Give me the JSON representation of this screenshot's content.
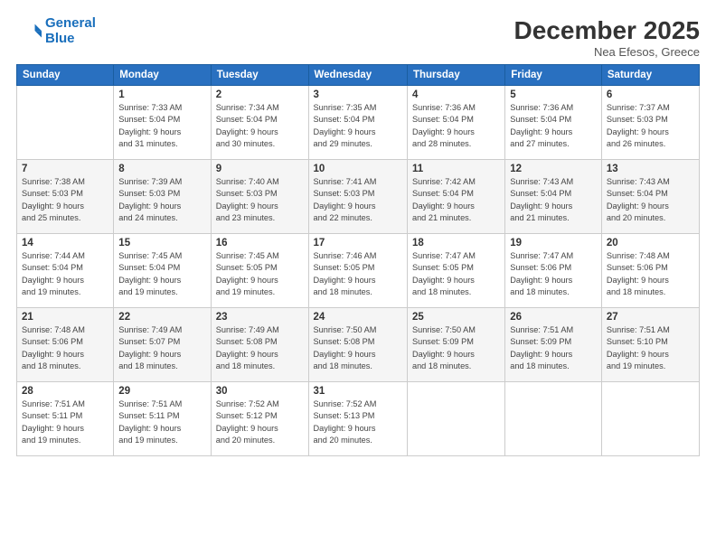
{
  "logo": {
    "line1": "General",
    "line2": "Blue"
  },
  "title": "December 2025",
  "location": "Nea Efesos, Greece",
  "header_days": [
    "Sunday",
    "Monday",
    "Tuesday",
    "Wednesday",
    "Thursday",
    "Friday",
    "Saturday"
  ],
  "weeks": [
    [
      {
        "day": "",
        "info": ""
      },
      {
        "day": "1",
        "info": "Sunrise: 7:33 AM\nSunset: 5:04 PM\nDaylight: 9 hours\nand 31 minutes."
      },
      {
        "day": "2",
        "info": "Sunrise: 7:34 AM\nSunset: 5:04 PM\nDaylight: 9 hours\nand 30 minutes."
      },
      {
        "day": "3",
        "info": "Sunrise: 7:35 AM\nSunset: 5:04 PM\nDaylight: 9 hours\nand 29 minutes."
      },
      {
        "day": "4",
        "info": "Sunrise: 7:36 AM\nSunset: 5:04 PM\nDaylight: 9 hours\nand 28 minutes."
      },
      {
        "day": "5",
        "info": "Sunrise: 7:36 AM\nSunset: 5:04 PM\nDaylight: 9 hours\nand 27 minutes."
      },
      {
        "day": "6",
        "info": "Sunrise: 7:37 AM\nSunset: 5:03 PM\nDaylight: 9 hours\nand 26 minutes."
      }
    ],
    [
      {
        "day": "7",
        "info": "Sunrise: 7:38 AM\nSunset: 5:03 PM\nDaylight: 9 hours\nand 25 minutes."
      },
      {
        "day": "8",
        "info": "Sunrise: 7:39 AM\nSunset: 5:03 PM\nDaylight: 9 hours\nand 24 minutes."
      },
      {
        "day": "9",
        "info": "Sunrise: 7:40 AM\nSunset: 5:03 PM\nDaylight: 9 hours\nand 23 minutes."
      },
      {
        "day": "10",
        "info": "Sunrise: 7:41 AM\nSunset: 5:03 PM\nDaylight: 9 hours\nand 22 minutes."
      },
      {
        "day": "11",
        "info": "Sunrise: 7:42 AM\nSunset: 5:04 PM\nDaylight: 9 hours\nand 21 minutes."
      },
      {
        "day": "12",
        "info": "Sunrise: 7:43 AM\nSunset: 5:04 PM\nDaylight: 9 hours\nand 21 minutes."
      },
      {
        "day": "13",
        "info": "Sunrise: 7:43 AM\nSunset: 5:04 PM\nDaylight: 9 hours\nand 20 minutes."
      }
    ],
    [
      {
        "day": "14",
        "info": "Sunrise: 7:44 AM\nSunset: 5:04 PM\nDaylight: 9 hours\nand 19 minutes."
      },
      {
        "day": "15",
        "info": "Sunrise: 7:45 AM\nSunset: 5:04 PM\nDaylight: 9 hours\nand 19 minutes."
      },
      {
        "day": "16",
        "info": "Sunrise: 7:45 AM\nSunset: 5:05 PM\nDaylight: 9 hours\nand 19 minutes."
      },
      {
        "day": "17",
        "info": "Sunrise: 7:46 AM\nSunset: 5:05 PM\nDaylight: 9 hours\nand 18 minutes."
      },
      {
        "day": "18",
        "info": "Sunrise: 7:47 AM\nSunset: 5:05 PM\nDaylight: 9 hours\nand 18 minutes."
      },
      {
        "day": "19",
        "info": "Sunrise: 7:47 AM\nSunset: 5:06 PM\nDaylight: 9 hours\nand 18 minutes."
      },
      {
        "day": "20",
        "info": "Sunrise: 7:48 AM\nSunset: 5:06 PM\nDaylight: 9 hours\nand 18 minutes."
      }
    ],
    [
      {
        "day": "21",
        "info": "Sunrise: 7:48 AM\nSunset: 5:06 PM\nDaylight: 9 hours\nand 18 minutes."
      },
      {
        "day": "22",
        "info": "Sunrise: 7:49 AM\nSunset: 5:07 PM\nDaylight: 9 hours\nand 18 minutes."
      },
      {
        "day": "23",
        "info": "Sunrise: 7:49 AM\nSunset: 5:08 PM\nDaylight: 9 hours\nand 18 minutes."
      },
      {
        "day": "24",
        "info": "Sunrise: 7:50 AM\nSunset: 5:08 PM\nDaylight: 9 hours\nand 18 minutes."
      },
      {
        "day": "25",
        "info": "Sunrise: 7:50 AM\nSunset: 5:09 PM\nDaylight: 9 hours\nand 18 minutes."
      },
      {
        "day": "26",
        "info": "Sunrise: 7:51 AM\nSunset: 5:09 PM\nDaylight: 9 hours\nand 18 minutes."
      },
      {
        "day": "27",
        "info": "Sunrise: 7:51 AM\nSunset: 5:10 PM\nDaylight: 9 hours\nand 19 minutes."
      }
    ],
    [
      {
        "day": "28",
        "info": "Sunrise: 7:51 AM\nSunset: 5:11 PM\nDaylight: 9 hours\nand 19 minutes."
      },
      {
        "day": "29",
        "info": "Sunrise: 7:51 AM\nSunset: 5:11 PM\nDaylight: 9 hours\nand 19 minutes."
      },
      {
        "day": "30",
        "info": "Sunrise: 7:52 AM\nSunset: 5:12 PM\nDaylight: 9 hours\nand 20 minutes."
      },
      {
        "day": "31",
        "info": "Sunrise: 7:52 AM\nSunset: 5:13 PM\nDaylight: 9 hours\nand 20 minutes."
      },
      {
        "day": "",
        "info": ""
      },
      {
        "day": "",
        "info": ""
      },
      {
        "day": "",
        "info": ""
      }
    ]
  ]
}
